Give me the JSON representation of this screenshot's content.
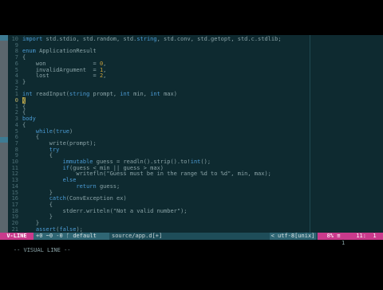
{
  "colors": {
    "editor_bg": "#0e2a30",
    "keyword": "#4b9bd4",
    "number": "#c9a03a",
    "mode_accent": "#c93a8c",
    "statusline_bg": "#1e4d59"
  },
  "editor": {
    "lines": [
      {
        "num": "10",
        "code": "import std.stdio, std.random, std.string, std.conv, std.getopt, std.c.stdlib;"
      },
      {
        "num": "9",
        "code": ""
      },
      {
        "num": "8",
        "code": "enum ApplicationResult"
      },
      {
        "num": "7",
        "code": "{"
      },
      {
        "num": "6",
        "code": "    won              = 0,"
      },
      {
        "num": "5",
        "code": "    invalidArgument  = 1,"
      },
      {
        "num": "4",
        "code": "    lost             = 2,"
      },
      {
        "num": "3",
        "code": "}"
      },
      {
        "num": "2",
        "code": ""
      },
      {
        "num": "1",
        "code": "int readInput(string prompt, int min, int max)"
      },
      {
        "num": "0",
        "code": "{",
        "cursor": true
      },
      {
        "num": "1",
        "code": "{"
      },
      {
        "num": "2",
        "code": "{"
      },
      {
        "num": "3",
        "code": "body"
      },
      {
        "num": "4",
        "code": "{"
      },
      {
        "num": "5",
        "code": "    while(true)"
      },
      {
        "num": "6",
        "code": "    {"
      },
      {
        "num": "7",
        "code": "        write(prompt);"
      },
      {
        "num": "8",
        "code": "        try"
      },
      {
        "num": "9",
        "code": "        {"
      },
      {
        "num": "10",
        "code": "            immutable guess = readln().strip().to!int();"
      },
      {
        "num": "11",
        "code": "            if(guess < min || guess > max)"
      },
      {
        "num": "12",
        "code": "                writefln(\"Guess must be in the range %d to %d\", min, max);"
      },
      {
        "num": "13",
        "code": "            else"
      },
      {
        "num": "14",
        "code": "                return guess;"
      },
      {
        "num": "15",
        "code": "        }"
      },
      {
        "num": "16",
        "code": "        catch(ConvException ex)"
      },
      {
        "num": "17",
        "code": "        {"
      },
      {
        "num": "18",
        "code": "            stderr.writeln(\"Not a valid number\");"
      },
      {
        "num": "19",
        "code": "        }"
      },
      {
        "num": "20",
        "code": "    }"
      },
      {
        "num": "21",
        "code": "    assert(false);"
      }
    ]
  },
  "statusline": {
    "mode": "V-LINE",
    "git": "+0 ~0 -0 ᚴ default",
    "file": "source/app.d[+]",
    "encoding": "< utf-8[unix]",
    "percent": "8% ≡",
    "position": "11:  1"
  },
  "cmdline": {
    "text": "-- VISUAL LINE --",
    "right": "1"
  }
}
